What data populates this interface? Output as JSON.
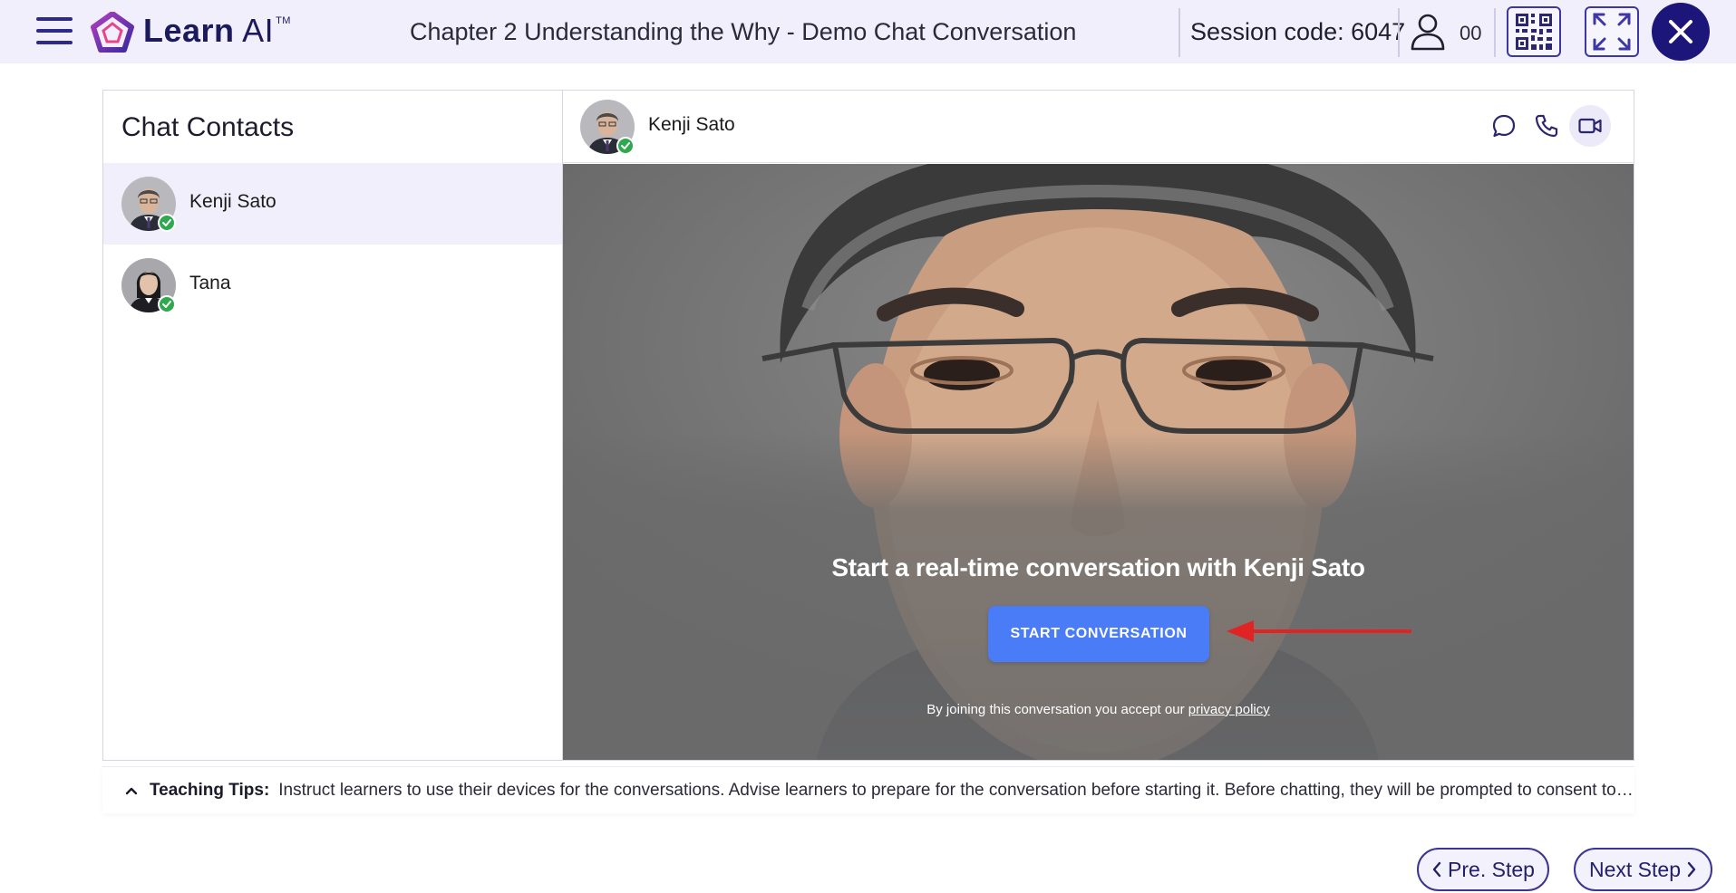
{
  "header": {
    "logo_primary": "Learn",
    "logo_secondary": "AI",
    "logo_trademark": "TM",
    "title": "Chapter 2 Understanding the Why - Demo Chat Conversation",
    "session_label": "Session code: 6047",
    "participant_count": "00"
  },
  "contacts": {
    "title": "Chat Contacts",
    "items": [
      {
        "name": "Kenji Sato",
        "status": "online",
        "active": true
      },
      {
        "name": "Tana",
        "status": "online",
        "active": false
      }
    ]
  },
  "chat": {
    "contact_name": "Kenji Sato",
    "active_mode": "video",
    "cta_title": "Start a real-time conversation with Kenji Sato",
    "cta_button": "START CONVERSATION",
    "privacy_prefix": "By joining this conversation you accept our",
    "privacy_link": "privacy policy"
  },
  "tips": {
    "label": "Teaching Tips:",
    "text": "Instruct learners to use their devices for the conversations. Advise learners to prepare for the conversation before starting it. Before chatting, they will be prompted to consent to ..."
  },
  "nav": {
    "prev_label": "Pre. Step",
    "next_label": "Next Step"
  },
  "colors": {
    "accent": "#1c167a",
    "button_blue": "#4a7cf7",
    "online_green": "#2fa84f",
    "header_bg": "#f1effb"
  }
}
